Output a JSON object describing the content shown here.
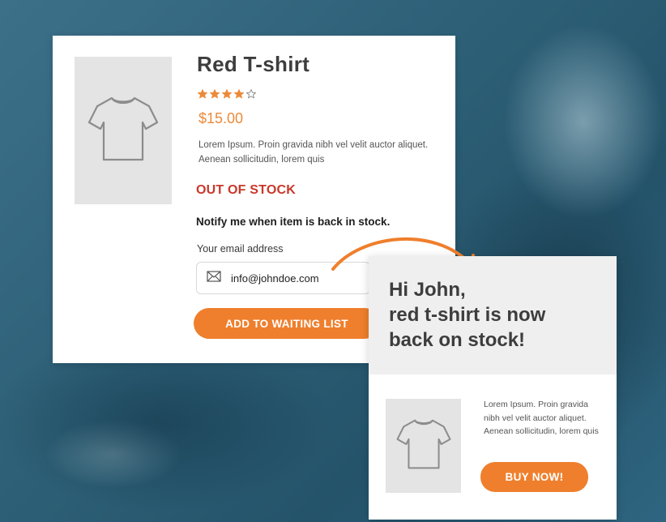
{
  "colors": {
    "accent": "#ef7f2c",
    "price": "#ec8a3a",
    "out_of_stock": "#c9382a",
    "image_placeholder": "#e4e4e4",
    "background": "#2d5f77"
  },
  "product": {
    "title": "Red T-shirt",
    "rating": 4,
    "rating_max": 5,
    "price": "$15.00",
    "description": "Lorem Ipsum. Proin gravida nibh vel velit auctor aliquet. Aenean sollicitudin, lorem quis",
    "image_icon": "tshirt-icon",
    "stock_status": "OUT OF STOCK"
  },
  "notify": {
    "heading": "Notify me when item is back in stock.",
    "email_label": "Your email address",
    "email_value": "info@johndoe.com",
    "email_icon": "envelope-icon",
    "submit_label": "ADD TO WAITING LIST"
  },
  "email_preview": {
    "headline_lines": [
      "Hi John,",
      "red t-shirt is now",
      "back on stock!"
    ],
    "image_icon": "tshirt-icon",
    "description": "Lorem Ipsum. Proin gravida nibh vel velit auctor aliquet. Aenean sollicitudin, lorem quis",
    "buy_label": "BUY NOW!"
  }
}
